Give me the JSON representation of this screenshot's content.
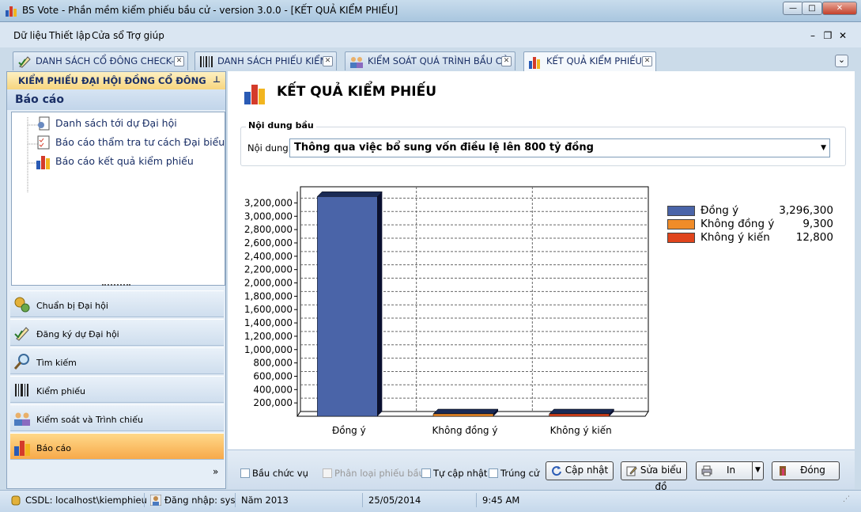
{
  "window": {
    "title": "BS Vote - Phần mềm kiểm phiếu bầu cử - version 3.0.0 - [KẾT QUẢ KIỂM PHIẾU]",
    "min": "—",
    "max": "□",
    "close": "✕"
  },
  "menu": {
    "items": [
      "Dữ liệu",
      "Thiết lập",
      "Cửa sổ",
      "Trợ giúp"
    ],
    "mdi_min": "–",
    "mdi_restore": "❐",
    "mdi_close": "✕"
  },
  "tabs": [
    {
      "label": "DANH SÁCH CỔ ĐÔNG CHECK-IN",
      "icon": "pencil-check-icon"
    },
    {
      "label": "DANH SÁCH PHIẾU KIỂM",
      "icon": "barcode-icon"
    },
    {
      "label": "KIỂM SOÁT QUÁ TRÌNH BẦU CỬ",
      "icon": "people-icon"
    },
    {
      "label": "KẾT QUẢ KIỂM PHIẾU",
      "icon": "bar-chart-icon"
    }
  ],
  "tab_close": "✕",
  "tab_overflow": "⌄",
  "sidebar": {
    "header": "KIỂM PHIẾU ĐẠI HỘI ĐỒNG CỔ ĐÔNG",
    "pin": "⊥",
    "section": "Báo cáo",
    "tree": [
      "Danh sách tới dự Đại hội",
      "Báo cáo thẩm tra tư cách Đại biểu",
      "Báo cáo kết quả kiểm phiếu"
    ],
    "nav": [
      "Chuẩn bị Đại hội",
      "Đăng ký dự Đại hội",
      "Tìm kiếm",
      "Kiểm phiếu",
      "Kiểm soát và Trình chiếu",
      "Báo cáo"
    ],
    "more": "»"
  },
  "main": {
    "title": "KẾT QUẢ KIỂM PHIẾU",
    "group_label": "Nội dung bầu",
    "content_label": "Nội dung:",
    "content_value": "Thông qua việc bổ sung vốn điều lệ lên 800 tỷ đồng",
    "dropdown_arrow": "▼"
  },
  "chart_data": {
    "type": "bar",
    "categories": [
      "Đồng ý",
      "Không đồng ý",
      "Không ý kiến"
    ],
    "values": [
      3296300,
      9300,
      12800
    ],
    "value_labels": [
      "3,296,300",
      "9,300",
      "12,800"
    ],
    "colors": [
      "#4a64a8",
      "#f08c28",
      "#e0441c"
    ],
    "yticks": [
      "200,000",
      "400,000",
      "600,000",
      "800,000",
      "1,000,000",
      "1,200,000",
      "1,400,000",
      "1,600,000",
      "1,800,000",
      "2,000,000",
      "2,200,000",
      "2,400,000",
      "2,600,000",
      "2,800,000",
      "3,000,000",
      "3,200,000"
    ],
    "ylim": [
      0,
      3300000
    ],
    "grid": true,
    "legend_position": "right"
  },
  "bottom": {
    "chk_position": "Bầu chức vụ",
    "chk_classify": "Phân loại phiếu bầu",
    "chk_autoupdate": "Tự cập nhật",
    "chk_elected": "Trúng cử",
    "btn_update": "Cập nhật",
    "btn_edit_chart": "Sửa biểu đồ",
    "btn_print": "In",
    "btn_close": "Đóng"
  },
  "status": {
    "db": "CSDL: localhost\\kiemphieu",
    "login": "Đăng nhập: sys",
    "year": "Năm 2013",
    "date": "25/05/2014",
    "time": "9:45 AM"
  }
}
